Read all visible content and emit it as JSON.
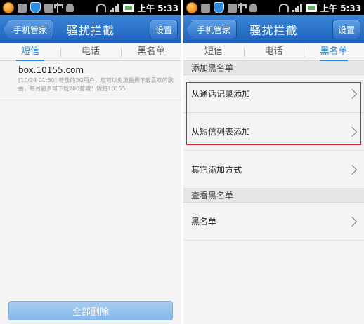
{
  "status_bar": {
    "time": "上午 5:33"
  },
  "left": {
    "back_label": "手机管家",
    "title": "骚扰拦截",
    "settings_label": "设置",
    "tabs": [
      "短信",
      "电话",
      "黑名单"
    ],
    "active_tab": 0,
    "message": {
      "sender": "box.10155.com",
      "preview": "[10/24 01:50] 尊敬的3G用户，您可以免流量费下载喜欢的歌曲，每月最多可下载200首哦！拨打10155"
    },
    "delete_all_label": "全部删除"
  },
  "right": {
    "back_label": "手机管家",
    "title": "骚扰拦截",
    "settings_label": "设置",
    "tabs": [
      "短信",
      "电话",
      "黑名单"
    ],
    "active_tab": 2,
    "section_add": "添加黑名单",
    "add_from_calls": "从通话记录添加",
    "add_from_sms": "从短信列表添加",
    "other_methods": "其它添加方式",
    "section_view": "查看黑名单",
    "blacklist": "黑名单"
  },
  "colors": {
    "titlebar": "#1e63bd",
    "tab_active": "#2d84d8",
    "highlight": "#d4232a"
  }
}
